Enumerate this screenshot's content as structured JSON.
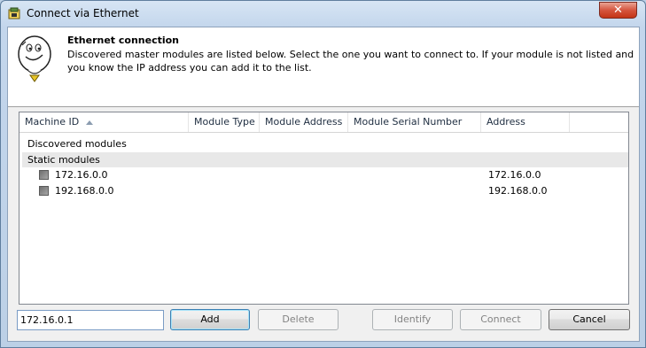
{
  "window": {
    "title": "Connect via Ethernet",
    "close_glyph": "✕"
  },
  "banner": {
    "title": "Ethernet connection",
    "text": "Discovered master modules are listed below. Select the one you want to connect to. If your module is not listed and you know the IP address you can add it to the list."
  },
  "table": {
    "columns": [
      "Machine ID",
      "Module Type",
      "Module Address",
      "Module Serial Number",
      "Address"
    ],
    "sorted_column": "Machine ID",
    "groups": [
      {
        "label": "Discovered modules",
        "rows": []
      },
      {
        "label": "Static modules",
        "rows": [
          {
            "machine_id": "172.16.0.0",
            "address": "172.16.0.0"
          },
          {
            "machine_id": "192.168.0.0",
            "address": "192.168.0.0"
          }
        ]
      }
    ]
  },
  "ip_input": {
    "value": "172.16.0.1"
  },
  "buttons": {
    "add": "Add",
    "delete": "Delete",
    "identify": "Identify",
    "connect": "Connect",
    "cancel": "Cancel"
  },
  "icons": {
    "app": "module-app-icon",
    "mascot": "lightbulb-face-icon",
    "sort": "sort-ascending-icon",
    "close": "close-icon"
  },
  "colors": {
    "titlebar": "#c3d6ec",
    "close_button": "#c43516",
    "selected_group": "#e8e8e8",
    "primary_button_border": "#3c7fb1"
  },
  "states": {
    "delete_enabled": false,
    "identify_enabled": false,
    "connect_enabled": false
  }
}
